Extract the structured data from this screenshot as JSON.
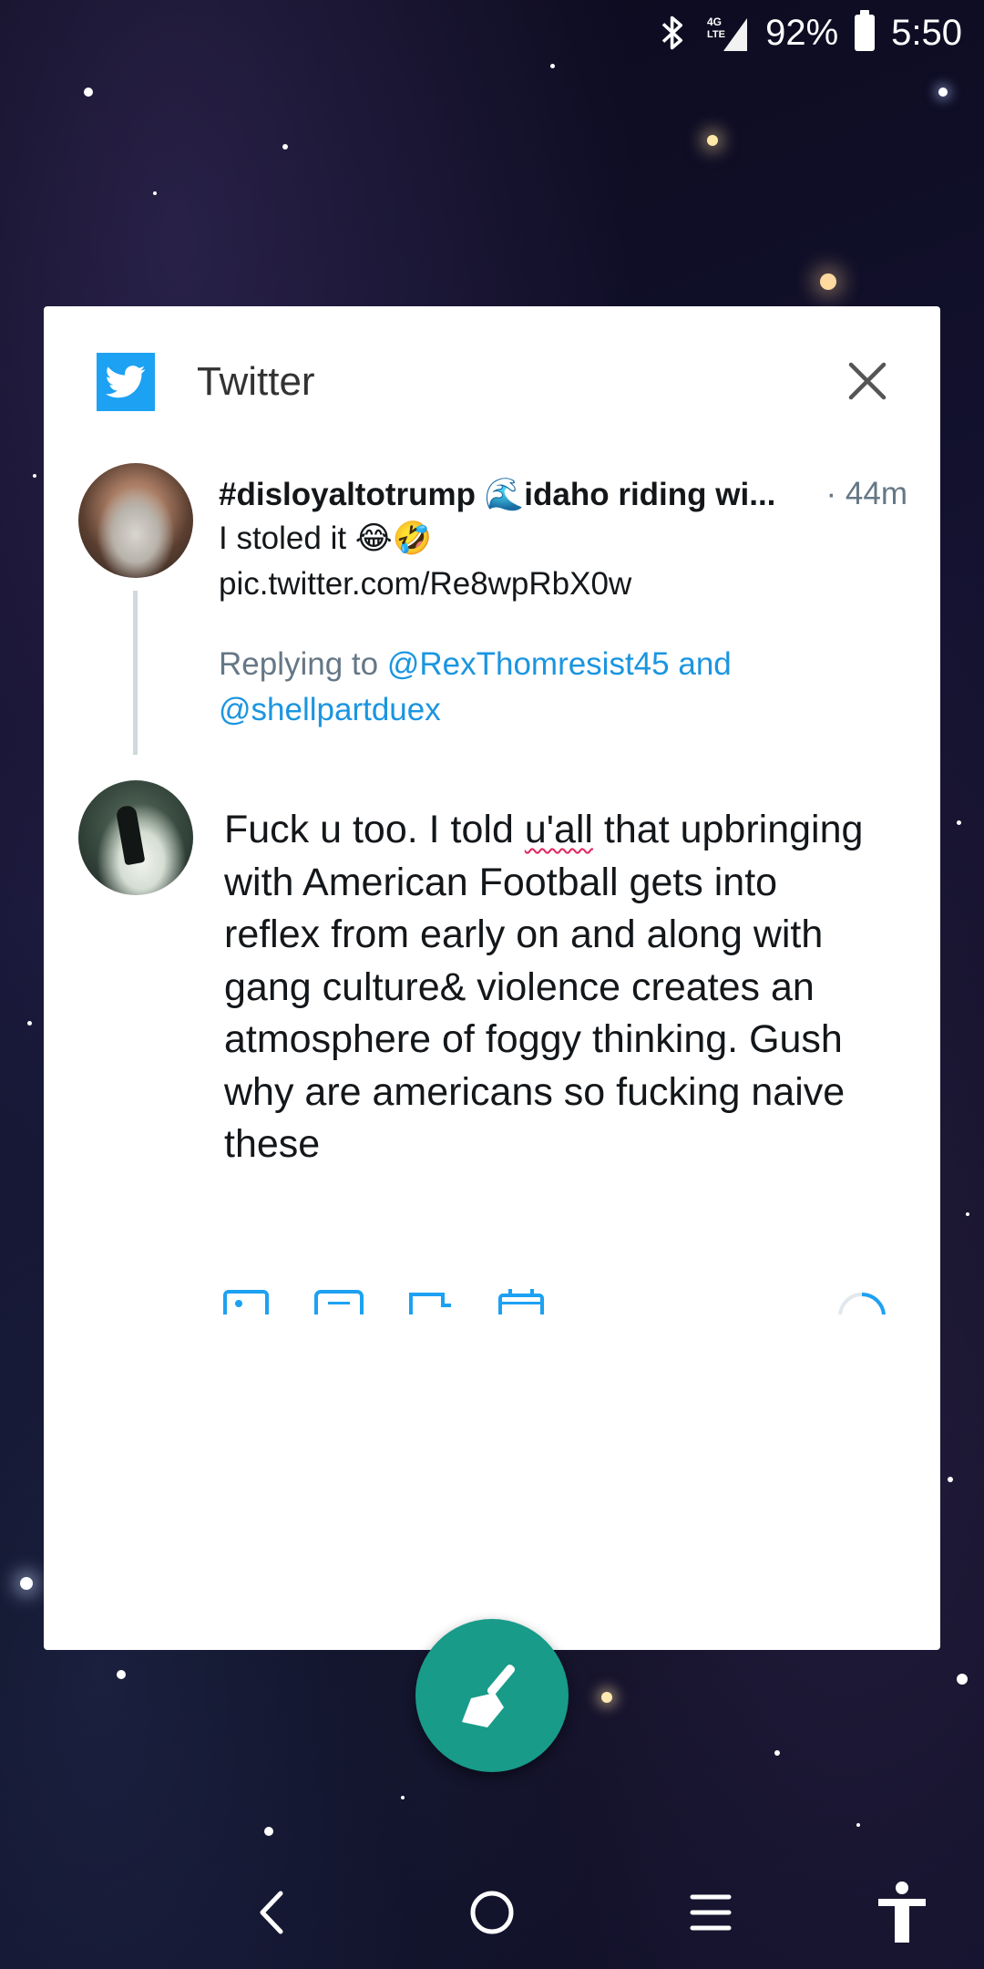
{
  "status_bar": {
    "network": "4G LTE",
    "battery": "92%",
    "time": "5:50"
  },
  "card": {
    "app_name": "Twitter",
    "original_tweet": {
      "author": "#disloyaltotrump 🌊idaho riding wi...",
      "time": "· 44m",
      "text": "I stoled it 😂🤣",
      "link": "pic.twitter.com/Re8wpRbX0w",
      "replying_prefix": "Replying to ",
      "mention_1": "@RexThomresist45",
      "mention_joiner": " and",
      "mention_2": "@shellpartduex"
    },
    "reply": {
      "text_before": "Fuck u too. I told ",
      "text_misspelled": "u'all",
      "text_after": " that upbringing with American Football gets into reflex from early on and along with gang culture& violence creates an atmosphere of foggy thinking. Gush why are americans so fucking naive these"
    }
  },
  "icons": {
    "app": "twitter-bird-icon",
    "close": "close-icon",
    "fab": "broom-clear-icon",
    "toolbar": [
      "image-icon",
      "gif-icon",
      "poll-icon",
      "schedule-icon"
    ],
    "nav": [
      "back-icon",
      "home-icon",
      "recents-icon",
      "accessibility-icon"
    ]
  },
  "colors": {
    "twitter_blue": "#1da1f2",
    "link_blue": "#1b95e0",
    "fab_teal": "#199b8a"
  }
}
